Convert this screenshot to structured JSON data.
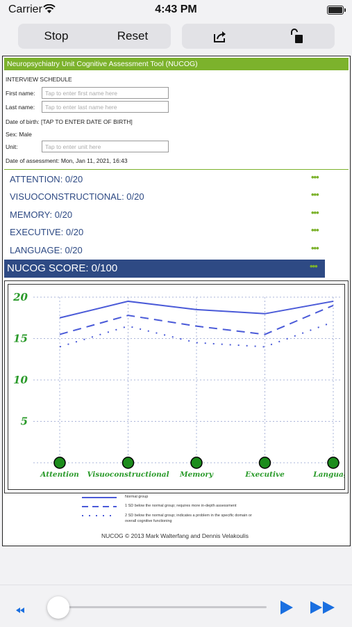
{
  "status": {
    "carrier": "Carrier",
    "time": "4:43 PM"
  },
  "toolbar": {
    "stop_label": "Stop",
    "reset_label": "Reset",
    "share_icon": "share-icon",
    "lock_icon": "unlock-icon"
  },
  "document": {
    "title": "Neuropsychiatry Unit Cognitive Assessment Tool (NUCOG)",
    "section_label": "INTERVIEW SCHEDULE",
    "first_name_label": "First name:",
    "first_name_placeholder": "Tap to enter first name here",
    "last_name_label": "Last name:",
    "last_name_placeholder": "Tap to enter last name here",
    "dob_text": "Date of birth: [TAP TO ENTER DATE OF BIRTH]",
    "sex_text": "Sex: Male",
    "unit_label": "Unit:",
    "unit_placeholder": "Tap to enter unit here",
    "assessment_date": "Date of assessment: Mon, Jan 11, 2021, 16:43"
  },
  "categories": [
    {
      "label": "ATTENTION: 0/20",
      "more": "•••"
    },
    {
      "label": "VISUOCONSTRUCTIONAL: 0/20",
      "more": "•••"
    },
    {
      "label": "MEMORY: 0/20",
      "more": "•••"
    },
    {
      "label": "EXECUTIVE: 0/20",
      "more": "•••"
    },
    {
      "label": "LANGUAGE: 0/20",
      "more": "•••"
    }
  ],
  "total": {
    "label": "NUCOG SCORE: 0/100",
    "more": "•••"
  },
  "chart_data": {
    "type": "line",
    "categories": [
      "Attention",
      "Visuoconstructional",
      "Memory",
      "Executive",
      "Language"
    ],
    "ylim": [
      0,
      20
    ],
    "yticks": [
      "20",
      "15",
      "10",
      "5"
    ],
    "series": [
      {
        "name": "Normal group",
        "style": "solid",
        "values": [
          17.5,
          19.5,
          18.5,
          18,
          19.5
        ]
      },
      {
        "name": "1 SD below the normal group; requires more in-depth assessment",
        "style": "dashed",
        "values": [
          15.5,
          17.8,
          16.5,
          15.5,
          19
        ]
      },
      {
        "name": "2 SD below the normal group; indicates a problem in the specific domain or overall cognitive functioning",
        "style": "dotted",
        "values": [
          14,
          16.5,
          14.5,
          14,
          17
        ]
      }
    ],
    "patient_scores": [
      0,
      0,
      0,
      0,
      0
    ],
    "line_color": "#4a5ad8",
    "tick_color": "#2a9a2a",
    "marker_color": "#1c8c1c"
  },
  "legend": [
    "Normal group",
    "1 SD below the normal group; requires more in-depth assessment",
    "2 SD below the normal group; indicates a problem in the specific domain or overall cognitive functioning"
  ],
  "copyright": "NUCOG © 2013 Mark Walterfang and Dennis Velakoulis",
  "player": {
    "progress": 0,
    "controls": [
      "rewind-icon",
      "play-icon",
      "fast-forward-icon"
    ]
  }
}
